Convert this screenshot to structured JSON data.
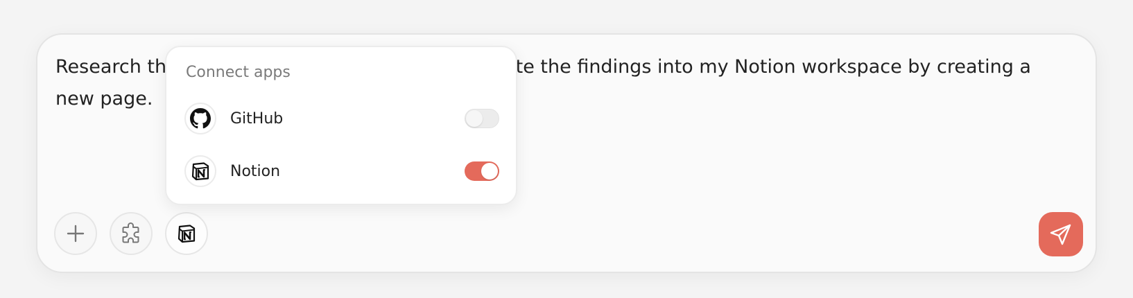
{
  "composer": {
    "prompt_visible_line1_start": "Research th",
    "prompt_visible_line1_end": "ite the findings into my Notion workspace by creating a",
    "prompt_visible_line2": "new page."
  },
  "toolbar": {
    "add_icon": "plus-icon",
    "plugins_icon": "puzzle-icon",
    "active_app_icon": "notion-icon",
    "send_icon": "paper-plane-icon"
  },
  "connect_apps": {
    "title": "Connect apps",
    "apps": [
      {
        "name": "GitHub",
        "icon": "github-icon",
        "enabled": false
      },
      {
        "name": "Notion",
        "icon": "notion-icon",
        "enabled": true
      }
    ]
  },
  "colors": {
    "accent": "#e46a5b",
    "toggle_off": "#ececec",
    "text": "#222222",
    "muted_text": "#7a7a7a"
  }
}
